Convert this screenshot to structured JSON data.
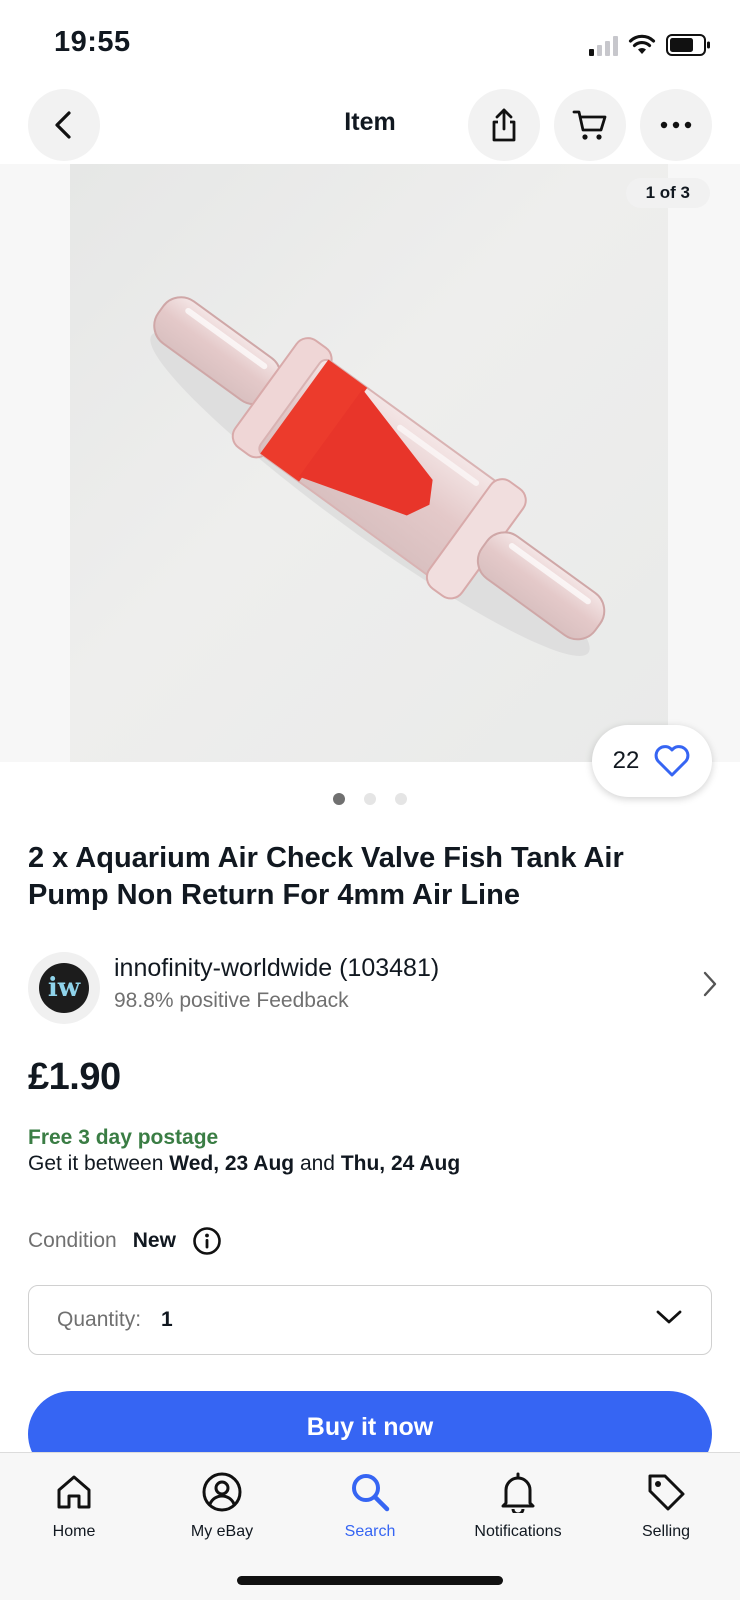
{
  "status_bar": {
    "time": "19:55"
  },
  "header": {
    "title": "Item"
  },
  "gallery": {
    "counter": "1 of 3",
    "total_images": 3,
    "active_index": 0,
    "watch_count": "22"
  },
  "item": {
    "title": "2 x Aquarium Air Check Valve Fish Tank Air Pump Non Return For 4mm Air Line",
    "price": "£1.90"
  },
  "seller": {
    "logo_letter": "iw",
    "name": "innofinity-worldwide (103481)",
    "feedback": "98.8% positive Feedback"
  },
  "shipping": {
    "postage": "Free 3 day postage",
    "delivery_prefix": "Get it between ",
    "delivery_start": "Wed, 23 Aug",
    "delivery_and": " and ",
    "delivery_end": "Thu, 24 Aug"
  },
  "condition": {
    "label": "Condition",
    "value": "New"
  },
  "quantity": {
    "label": "Quantity:",
    "value": "1"
  },
  "buy_button": {
    "label": "Buy it now"
  },
  "tab_bar": {
    "items": [
      {
        "label": "Home",
        "icon": "home-icon"
      },
      {
        "label": "My eBay",
        "icon": "user-icon"
      },
      {
        "label": "Search",
        "icon": "search-icon"
      },
      {
        "label": "Notifications",
        "icon": "bell-icon"
      },
      {
        "label": "Selling",
        "icon": "tag-icon"
      }
    ],
    "active": "Search"
  },
  "colors": {
    "accent": "#3665f3",
    "postage_green": "#3a7d44",
    "text": "#111820",
    "muted": "#707070"
  }
}
